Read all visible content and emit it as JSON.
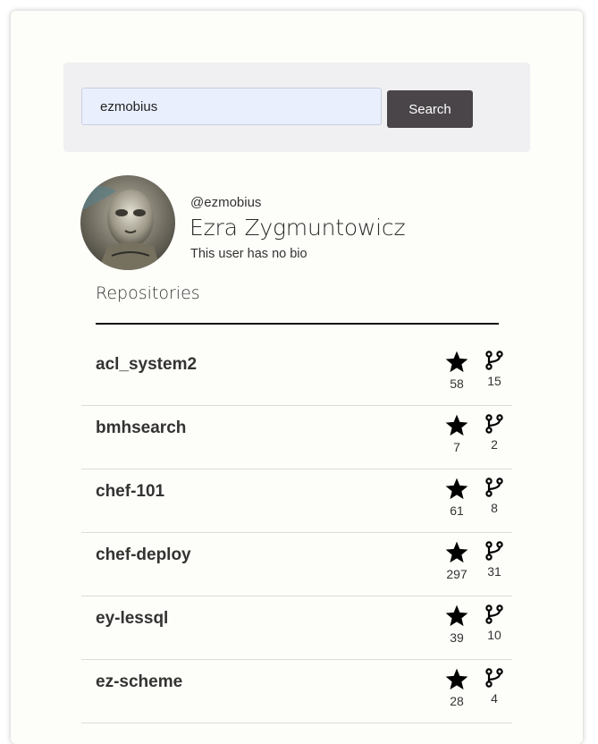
{
  "search": {
    "value": "ezmobius",
    "button_label": "Search"
  },
  "profile": {
    "handle": "@ezmobius",
    "name": "Ezra Zygmuntowicz",
    "bio": "This user has no bio"
  },
  "repos_heading": "Repositories",
  "repos": [
    {
      "name": "acl_system2",
      "stars": "58",
      "forks": "15"
    },
    {
      "name": "bmhsearch",
      "stars": "7",
      "forks": "2"
    },
    {
      "name": "chef-101",
      "stars": "61",
      "forks": "8"
    },
    {
      "name": "chef-deploy",
      "stars": "297",
      "forks": "31"
    },
    {
      "name": "ey-lessql",
      "stars": "39",
      "forks": "10"
    },
    {
      "name": "ez-scheme",
      "stars": "28",
      "forks": "4"
    }
  ],
  "icons": {
    "star": "star-icon",
    "fork": "fork-icon"
  },
  "colors": {
    "search_button": "#4a4548",
    "input_bg": "#e9effd",
    "panel_bg": "#f0f0f2"
  }
}
